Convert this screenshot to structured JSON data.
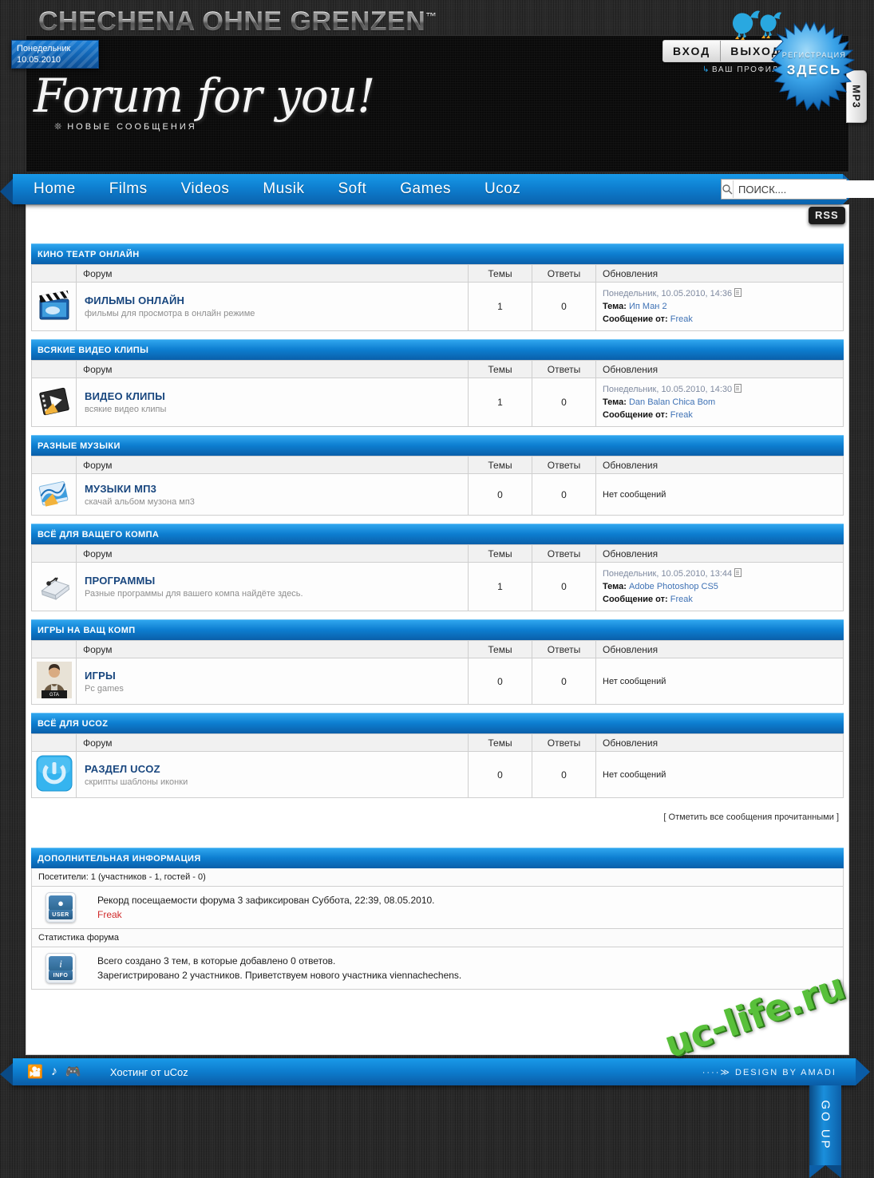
{
  "site": {
    "title": "CHECHENA OHNE GRENZEN",
    "trademark": "™",
    "logo_script": "Forum for you!",
    "logo_sub": "НОВЫЕ СООБЩЕНИЯ",
    "date_line1": "Понедельник",
    "date_line2": "10.05.2010"
  },
  "auth": {
    "login": "ВХОД",
    "logout": "ВЫХОД",
    "profile": "ВАШ ПРОФИЛЬ",
    "register_line1": "РЕГИСТРАЦИЯ",
    "register_line2": "ЗДЕСЬ"
  },
  "side_tab": {
    "mp3": "MP3"
  },
  "nav": {
    "items": [
      {
        "label": "Home"
      },
      {
        "label": "Films"
      },
      {
        "label": "Videos"
      },
      {
        "label": "Musik"
      },
      {
        "label": "Soft"
      },
      {
        "label": "Games"
      },
      {
        "label": "Ucoz"
      }
    ]
  },
  "search": {
    "placeholder": "ПОИСК....",
    "value": ""
  },
  "rss": {
    "label": "RSS"
  },
  "table_headers": {
    "forum": "Форум",
    "topics": "Темы",
    "replies": "Ответы",
    "updates": "Обновления"
  },
  "labels": {
    "theme": "Тема:",
    "message_from": "Сообщение от:",
    "no_messages": "Нет сообщений",
    "mark_all_read": "[ Отметить все сообщения прочитанными ]"
  },
  "sections": [
    {
      "category": "КИНО ТЕАТР ОНЛАЙН",
      "icon": "film-clapper-icon",
      "forum_title": "ФИЛЬМЫ ОНЛАЙН",
      "forum_desc": "фильмы для просмотра в онлайн режиме",
      "topics": "1",
      "replies": "0",
      "has_update": true,
      "update_date": "Понедельник, 10.05.2010, 14:36",
      "update_topic": "Ип Ман 2",
      "update_author": "Freak"
    },
    {
      "category": "ВСЯКИЕ ВИДЕО КЛИПЫ",
      "icon": "video-film-icon",
      "forum_title": "ВИДЕО КЛИПЫ",
      "forum_desc": "всякие видео клипы",
      "topics": "1",
      "replies": "0",
      "has_update": true,
      "update_date": "Понедельник, 10.05.2010, 14:30",
      "update_topic": "Dan Balan Chica Bom",
      "update_author": "Freak"
    },
    {
      "category": "РАЗНЫЕ МУЗЫКИ",
      "icon": "music-notes-icon",
      "forum_title": "МУЗЫКИ МП3",
      "forum_desc": "скачай альбом музона мп3",
      "topics": "0",
      "replies": "0",
      "has_update": false,
      "update_date": "",
      "update_topic": "",
      "update_author": ""
    },
    {
      "category": "ВСЁ ДЛЯ ВАЩЕГО КОМПА",
      "icon": "usb-drive-icon",
      "forum_title": "ПРОГРАММЫ",
      "forum_desc": "Разные программы для вашего компа найдёте здесь.",
      "topics": "1",
      "replies": "0",
      "has_update": true,
      "update_date": "Понедельник, 10.05.2010, 13:44",
      "update_topic": "Adobe Photoshop CS5",
      "update_author": "Freak"
    },
    {
      "category": "ИГРЫ НА ВАЩ КОМП",
      "icon": "gta-character-icon",
      "forum_title": "ИГРЫ",
      "forum_desc": "Pc games",
      "topics": "0",
      "replies": "0",
      "has_update": false,
      "update_date": "",
      "update_topic": "",
      "update_author": ""
    },
    {
      "category": "ВСЁ ДЛЯ UCOZ",
      "icon": "ucoz-power-icon",
      "forum_title": "РАЗДЕЛ UCOZ",
      "forum_desc": "скрипты шаблоны иконки",
      "topics": "0",
      "replies": "0",
      "has_update": false,
      "update_date": "",
      "update_topic": "",
      "update_author": ""
    }
  ],
  "extra": {
    "heading": "ДОПОЛНИТЕЛЬНАЯ ИНФОРМАЦИЯ",
    "visitors_line": "Посетители: 1  (участников - 1, гостей - 0)",
    "record_line": "Рекорд посещаемости форума 3 зафиксирован Суббота, 22:39, 08.05.2010.",
    "record_user": "Freak",
    "stats_heading": "Статистика форума",
    "stats_line1": "Всего создано 3 тем, в которые добавлено 0 ответов.",
    "stats_line2": "Зарегистрировано 2 участников. Приветствуем нового участника viennachechens.",
    "user_badge": "USER",
    "info_badge": "INFO"
  },
  "footer": {
    "hosting": "Хостинг от uCoz",
    "design": "DESIGN BY AMADI",
    "design_arrow": "····≫",
    "go_up": "GO UP"
  },
  "watermark": {
    "text": "uc-life.ru"
  },
  "colors": {
    "accent_blue": "#0d7ed0",
    "light_blue": "#2fa6ee",
    "dark_blue": "#0a5fa9",
    "link_blue": "#18467e",
    "update_link": "#3f72b5",
    "red": "#d12b2b",
    "watermark_green": "#58c03a",
    "page_bg": "#2b2b2b"
  }
}
